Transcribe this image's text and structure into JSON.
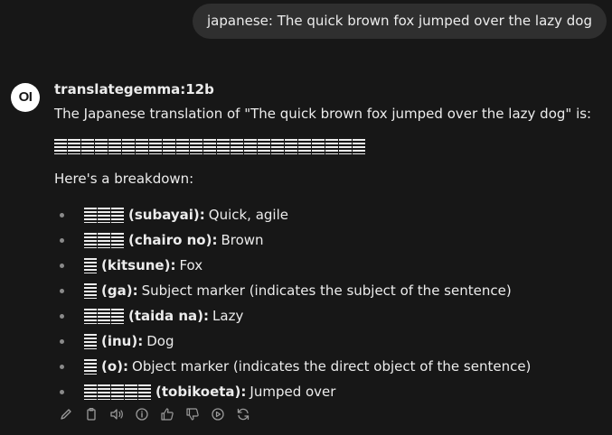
{
  "user_message": "japanese: The quick brown fox jumped over the lazy dog",
  "assistant": {
    "avatar_text": "OI",
    "model_name": "translategemma:12b",
    "intro": "The Japanese translation of \"The quick brown fox jumped over the lazy dog\" is:",
    "translation_glyph_count": 23,
    "breakdown_heading": "Here's a breakdown:",
    "breakdown": [
      {
        "glyph_count": 3,
        "term": "(subayai):",
        "desc": "Quick, agile"
      },
      {
        "glyph_count": 3,
        "term": "(chairo no):",
        "desc": "Brown"
      },
      {
        "glyph_count": 1,
        "term": "(kitsune):",
        "desc": "Fox"
      },
      {
        "glyph_count": 1,
        "term": "(ga):",
        "desc": "Subject marker (indicates the subject of the sentence)"
      },
      {
        "glyph_count": 3,
        "term": "(taida na):",
        "desc": "Lazy"
      },
      {
        "glyph_count": 1,
        "term": "(inu):",
        "desc": "Dog"
      },
      {
        "glyph_count": 1,
        "term": "(o):",
        "desc": "Object marker (indicates the direct object of the sentence)"
      },
      {
        "glyph_count": 5,
        "term": "(tobikoeta):",
        "desc": "Jumped over"
      }
    ],
    "actions": [
      "edit-icon",
      "copy-icon",
      "read-aloud-icon",
      "info-icon",
      "thumbs-up-icon",
      "thumbs-down-icon",
      "continue-icon",
      "regenerate-icon"
    ]
  },
  "colors": {
    "background": "#171717",
    "bubble": "#2f2f2f",
    "text": "#ececec",
    "muted": "#8a8a8a"
  }
}
